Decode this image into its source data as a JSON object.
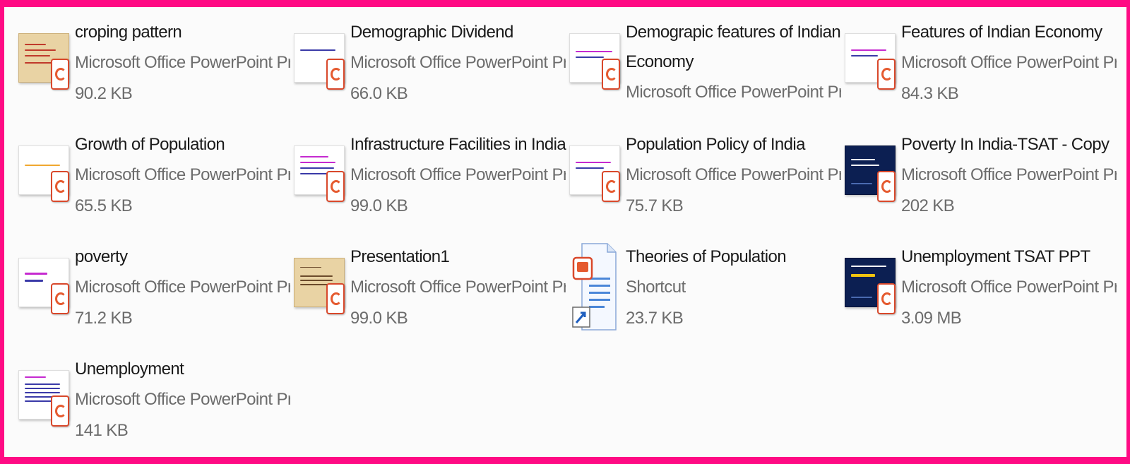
{
  "files": [
    {
      "name": "croping pattern",
      "type": "Microsoft Office PowerPoint Pres...",
      "size": "90.2 KB",
      "thumb": "beige"
    },
    {
      "name": "Demographic Dividend",
      "type": "Microsoft Office PowerPoint Pres...",
      "size": "66.0 KB",
      "thumb": "white"
    },
    {
      "name": "Demograpic features of Indian Economy",
      "type": "Microsoft Office PowerPoint Pres...",
      "size": "",
      "thumb": "white"
    },
    {
      "name": "Features of Indian Economy",
      "type": "Microsoft Office PowerPoint Pres...",
      "size": "84.3 KB",
      "thumb": "white"
    },
    {
      "name": "Growth of Population",
      "type": "Microsoft Office PowerPoint Pres...",
      "size": "65.5 KB",
      "thumb": "white"
    },
    {
      "name": "Infrastructure Facilities in India",
      "type": "Microsoft Office PowerPoint Pres...",
      "size": "99.0 KB",
      "thumb": "white"
    },
    {
      "name": "Population Policy of India",
      "type": "Microsoft Office PowerPoint Pres...",
      "size": "75.7 KB",
      "thumb": "white"
    },
    {
      "name": "Poverty In India-TSAT - Copy",
      "type": "Microsoft Office PowerPoint Pres...",
      "size": "202 KB",
      "thumb": "navy"
    },
    {
      "name": "poverty",
      "type": "Microsoft Office PowerPoint Pres...",
      "size": "71.2 KB",
      "thumb": "white"
    },
    {
      "name": "Presentation1",
      "type": "Microsoft Office PowerPoint Pres...",
      "size": "99.0 KB",
      "thumb": "beige"
    },
    {
      "name": "Theories of Population",
      "type": "Shortcut",
      "size": "23.7 KB",
      "thumb": "shortcut"
    },
    {
      "name": "Unemployment TSAT PPT",
      "type": "Microsoft Office PowerPoint Pres...",
      "size": "3.09 MB",
      "thumb": "navy"
    },
    {
      "name": "Unemployment",
      "type": "Microsoft Office PowerPoint Pres...",
      "size": "141 KB",
      "thumb": "white"
    }
  ],
  "colors": {
    "border": "#ff0a84",
    "name_text": "#1a1a1a",
    "meta_text": "#6c6c6c",
    "ppt_accent": "#d9482b"
  }
}
